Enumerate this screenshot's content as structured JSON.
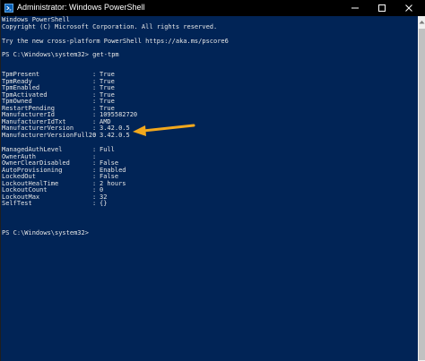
{
  "window": {
    "title": "Administrator: Windows PowerShell",
    "icon": "powershell-icon",
    "controls": [
      "minimize-icon",
      "maximize-icon",
      "close-icon"
    ]
  },
  "console": {
    "banner": [
      "Windows PowerShell",
      "Copyright (C) Microsoft Corporation. All rights reserved.",
      "",
      "Try the new cross-platform PowerShell https://aka.ms/pscore6"
    ],
    "prompt1": "PS C:\\Windows\\system32> get-tpm",
    "group1": [
      {
        "key": "TpmPresent",
        "value": "True"
      },
      {
        "key": "TpmReady",
        "value": "True"
      },
      {
        "key": "TpmEnabled",
        "value": "True"
      },
      {
        "key": "TpmActivated",
        "value": "True"
      },
      {
        "key": "TpmOwned",
        "value": "True"
      },
      {
        "key": "RestartPending",
        "value": "True"
      },
      {
        "key": "ManufacturerId",
        "value": "1095582720"
      },
      {
        "key": "ManufacturerIdTxt",
        "value": "AMD"
      },
      {
        "key": "ManufacturerVersion",
        "value": "3.42.0.5"
      },
      {
        "key": "ManufacturerVersionFull20",
        "value": "3.42.0.5"
      }
    ],
    "group2": [
      {
        "key": "ManagedAuthLevel",
        "value": "Full"
      },
      {
        "key": "OwnerAuth",
        "value": ""
      },
      {
        "key": "OwnerClearDisabled",
        "value": "False"
      },
      {
        "key": "AutoProvisioning",
        "value": "Enabled"
      },
      {
        "key": "LockedOut",
        "value": "False"
      },
      {
        "key": "LockoutHealTime",
        "value": "2 hours"
      },
      {
        "key": "LockoutCount",
        "value": "0"
      },
      {
        "key": "LockoutMax",
        "value": "32"
      },
      {
        "key": "SelfTest",
        "value": "{}"
      }
    ],
    "separator": ":",
    "prompt2": "PS C:\\Windows\\system32>"
  },
  "annotation": {
    "icon": "arrow-left-icon",
    "color": "#f2a81d"
  },
  "colors": {
    "console_background": "#012456",
    "console_text": "#e6e6e6",
    "titlebar": "#000000"
  }
}
